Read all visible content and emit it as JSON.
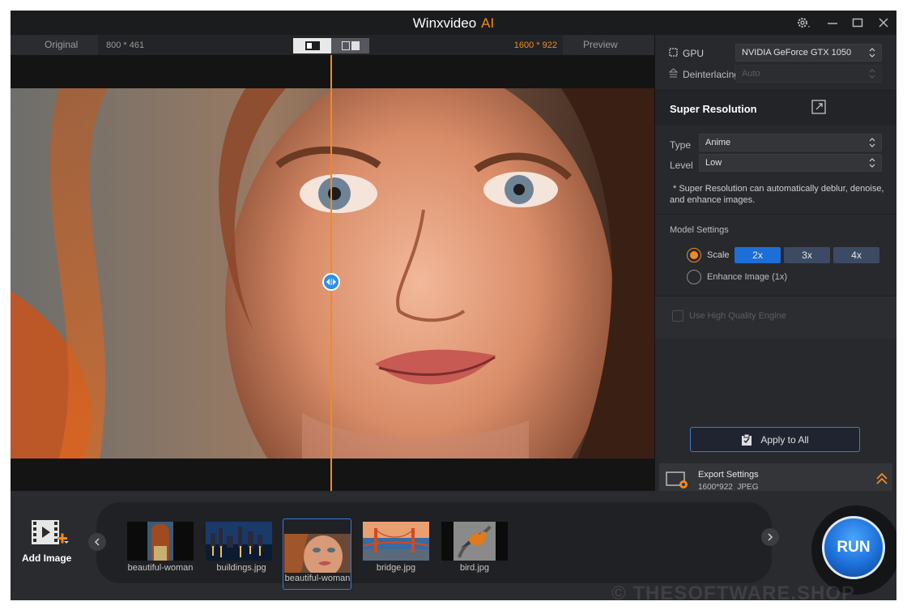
{
  "app": {
    "title": "Winxvideo",
    "title_suffix": "AI"
  },
  "preview": {
    "original_label": "Original",
    "original_size": "800 * 461",
    "preview_label": "Preview",
    "preview_size": "1600 * 922",
    "split_position_fraction": 0.5
  },
  "settings": {
    "gpu_label": "GPU",
    "gpu_value": "NVIDIA GeForce GTX 1050",
    "deinterlacing_label": "Deinterlacing",
    "deinterlacing_value": "Auto",
    "super_resolution_title": "Super Resolution",
    "type_label": "Type",
    "type_value": "Anime",
    "level_label": "Level",
    "level_value": "Low",
    "note": "* Super Resolution can automatically deblur, denoise, and enhance images.",
    "model_settings_label": "Model Settings",
    "scale_label": "Scale",
    "scale_options": [
      "2x",
      "3x",
      "4x"
    ],
    "scale_selected": "2x",
    "enhance_label": "Enhance Image (1x)",
    "hq_engine_label": "Use High Quality Engine",
    "apply_all_label": "Apply to All",
    "export_title": "Export Settings",
    "export_detail": "1600*922  JPEG"
  },
  "filmstrip": {
    "add_image_label": "Add Image",
    "items": [
      {
        "name": "beautiful-woman",
        "selected": false
      },
      {
        "name": "buildings.jpg",
        "selected": false
      },
      {
        "name": "beautiful-woman",
        "selected": true
      },
      {
        "name": "bridge.jpg",
        "selected": false
      },
      {
        "name": "bird.jpg",
        "selected": false
      }
    ]
  },
  "run_label": "RUN",
  "watermark": "© THESOFTWARE.SHOP",
  "colors": {
    "accent": "#f08b1e",
    "blue": "#1d6fd8",
    "bg": "#1d1e20"
  }
}
